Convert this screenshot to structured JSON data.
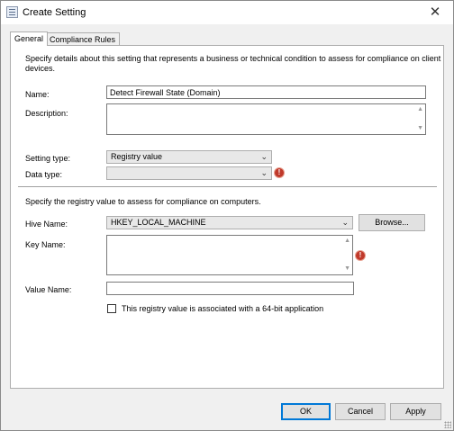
{
  "window": {
    "title": "Create Setting",
    "close_glyph": "✕",
    "icon": "settings-dialog-icon"
  },
  "tabs": [
    {
      "label": "General",
      "selected": true
    },
    {
      "label": "Compliance Rules",
      "selected": false
    }
  ],
  "general": {
    "intro": "Specify details about this setting that represents a business or technical condition to assess for compliance on client devices.",
    "intro_line1": "Specify details about this setting that represents a business or technical condition to assess for compliance on client",
    "intro_line2": "devices.",
    "name": {
      "label": "Name:",
      "value": "Detect Firewall State (Domain)"
    },
    "description": {
      "label": "Description:",
      "value": ""
    },
    "setting_type": {
      "label": "Setting type:",
      "value": "Registry value"
    },
    "data_type": {
      "label": "Data type:",
      "value": ""
    },
    "registry_intro": "Specify the registry value to assess for compliance on computers.",
    "hive_name": {
      "label": "Hive Name:",
      "value": "HKEY_LOCAL_MACHINE"
    },
    "browse_label": "Browse...",
    "key_name": {
      "label": "Key Name:",
      "value": ""
    },
    "value_name": {
      "label": "Value Name:",
      "value": ""
    },
    "is64bit": {
      "label": "This registry value is associated with a 64-bit application",
      "checked": false
    },
    "warning_glyph": "!",
    "dropdown_glyph": "⌄",
    "scroll_up_glyph": "▲",
    "scroll_down_glyph": "▼"
  },
  "buttons": {
    "ok": "OK",
    "cancel": "Cancel",
    "apply": "Apply"
  },
  "colors": {
    "accent": "#0078d7",
    "warning": "#c0392b"
  }
}
